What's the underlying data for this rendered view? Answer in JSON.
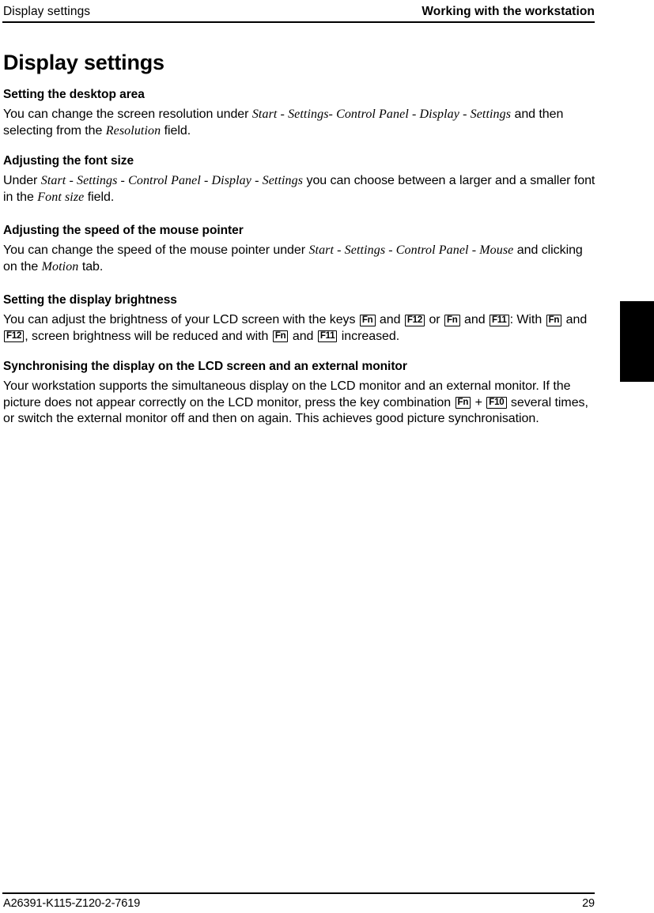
{
  "header": {
    "left": "Display settings",
    "right": "Working with the workstation"
  },
  "title": "Display settings",
  "sections": [
    {
      "heading": "Setting the desktop area",
      "paragraph": {
        "p1": "You can change the screen resolution under ",
        "path1": "Start - Settings- Control Panel - Display - Settings",
        "p2": " and then selecting from the ",
        "path2": "Resolution",
        "p3": " field."
      }
    },
    {
      "heading": "Adjusting the font size",
      "paragraph": {
        "p1": "Under ",
        "path1": "Start - Settings - Control Panel - Display - Settings",
        "p2": " you can choose between a larger and a smaller font in the ",
        "path2": "Font size",
        "p3": " field."
      }
    },
    {
      "heading": "Adjusting the speed of the mouse pointer",
      "paragraph": {
        "p1": "You can change the speed of the mouse pointer under ",
        "path1": "Start - Settings - Control Panel - Mouse",
        "p2": " and clicking on the ",
        "path2": "Motion",
        "p3": " tab."
      }
    },
    {
      "heading": "Setting the display brightness",
      "paragraph": {
        "t1": "You can adjust the brightness of your LCD screen with the keys ",
        "key1": "Fn",
        "t2": " and ",
        "key2": "F12",
        "t3": " or ",
        "key3": "Fn",
        "t4": " and ",
        "key4": "F11",
        "t5": ": With ",
        "key5": "Fn",
        "t6": " and ",
        "key6": "F12",
        "t7": ", screen brightness will be reduced and with ",
        "key7": "Fn",
        "t8": " and ",
        "key8": "F11",
        "t9": " increased."
      }
    },
    {
      "heading": "Synchronising the display on the LCD screen and an external monitor",
      "paragraph": {
        "t1": "Your workstation supports the simultaneous display on the LCD monitor and an external monitor. If the picture does not appear correctly on the LCD monitor, press the key combination ",
        "key1": "Fn",
        "t2": " + ",
        "key2": "F10",
        "t3": " several times, or switch the external monitor off and then on again. This achieves good picture synchronisation."
      }
    }
  ],
  "footer": {
    "document_id": "A26391-K115-Z120-2-7619",
    "page_number": "29"
  },
  "colors": {
    "ink": "#000000",
    "paper": "#ffffff"
  }
}
